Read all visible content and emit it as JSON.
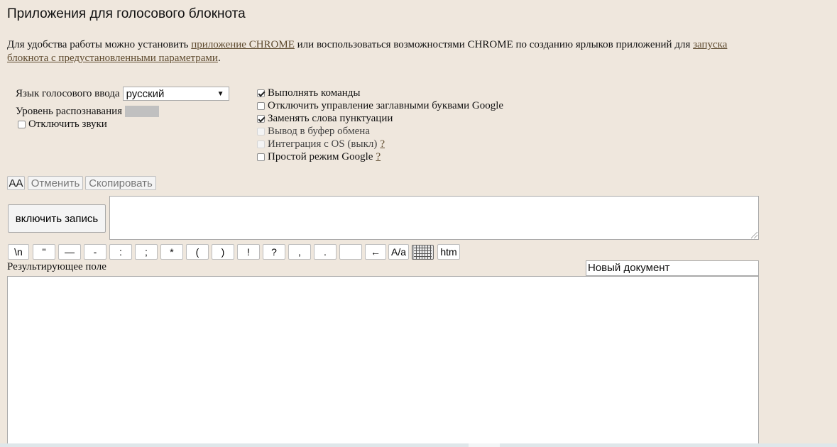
{
  "page": {
    "title": "Приложения для голосового блокнота"
  },
  "intro": {
    "text1": "Для удобства работы можно установить ",
    "link1": "приложение CHROME",
    "text2": " или воспользоваться возможностями CHROME по созданию ярлыков приложений для ",
    "link2": "запуска блокнота с предустановленными параметрами",
    "text3": "."
  },
  "settings": {
    "language_label": "Язык голосового ввода",
    "language_value": "русский",
    "recognition_label": "Уровень распознавания",
    "mute_label": "Отключить звуки",
    "options": [
      {
        "label": "Выполнять команды",
        "checked": true,
        "disabled": false
      },
      {
        "label": "Отключить управление заглавными буквами Google",
        "checked": false,
        "disabled": false
      },
      {
        "label": "Заменять слова пунктуации",
        "checked": true,
        "disabled": false
      },
      {
        "label": "Вывод в буфер обмена",
        "checked": false,
        "disabled": true
      },
      {
        "label": "Интеграция с OS (выкл)",
        "checked": false,
        "disabled": true,
        "help": "?"
      },
      {
        "label": "Простой режим Google",
        "checked": false,
        "disabled": false,
        "help": "?"
      }
    ]
  },
  "toolbar": {
    "case_label": "AA",
    "undo_label": "Отменить",
    "copy_label": "Скопировать",
    "record_label": "включить запись"
  },
  "punctuation": [
    "\\n",
    "\"",
    "—",
    "-",
    ":",
    ";",
    "*",
    "(",
    ")",
    "!",
    "?",
    ",",
    ".",
    "",
    "←",
    "A/a",
    "htm"
  ],
  "result": {
    "label": "Результирующее поле",
    "doc_name": "Новый документ"
  }
}
